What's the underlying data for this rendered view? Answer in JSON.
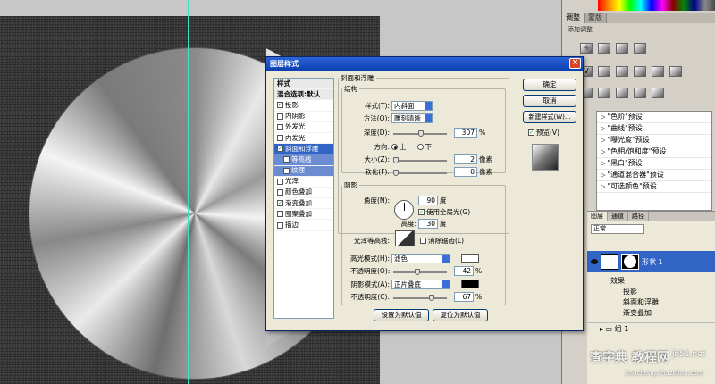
{
  "dialog": {
    "title": "图层样式",
    "style_list": {
      "header": "样式",
      "blend_options": "混合选项:默认",
      "items": [
        {
          "label": "投影",
          "checked": true
        },
        {
          "label": "内阴影",
          "checked": false
        },
        {
          "label": "外发光",
          "checked": false
        },
        {
          "label": "内发光",
          "checked": false
        },
        {
          "label": "斜面和浮雕",
          "checked": true,
          "selected": true
        },
        {
          "label": "等高线",
          "checked": false,
          "sub": true
        },
        {
          "label": "纹理",
          "checked": false,
          "sub": true
        },
        {
          "label": "光泽",
          "checked": false
        },
        {
          "label": "颜色叠加",
          "checked": false
        },
        {
          "label": "渐变叠加",
          "checked": true
        },
        {
          "label": "图案叠加",
          "checked": false
        },
        {
          "label": "描边",
          "checked": false
        }
      ]
    },
    "bevel": {
      "group_title": "斜面和浮雕",
      "structure_title": "结构",
      "style_label": "样式(T):",
      "style_value": "内斜面",
      "technique_label": "方法(Q):",
      "technique_value": "雕刻清晰",
      "depth_label": "深度(D):",
      "depth_value": "307",
      "depth_unit": "%",
      "direction_label": "方向:",
      "direction_up": "上",
      "direction_down": "下",
      "size_label": "大小(Z):",
      "size_value": "2",
      "size_unit": "像素",
      "soften_label": "软化(F):",
      "soften_value": "0",
      "soften_unit": "像素"
    },
    "shading": {
      "title": "阴影",
      "angle_label": "角度(N):",
      "angle_value": "90",
      "angle_unit": "度",
      "global_light_label": "使用全局光(G)",
      "altitude_label": "高度:",
      "altitude_value": "30",
      "altitude_unit": "度",
      "gloss_label": "光泽等高线:",
      "antialias_label": "消除锯齿(L)",
      "highlight_mode_label": "高光模式(H):",
      "highlight_mode_value": "滤色",
      "highlight_opacity_label": "不透明度(O):",
      "highlight_opacity_value": "42",
      "shadow_mode_label": "阴影模式(A):",
      "shadow_mode_value": "正片叠底",
      "shadow_opacity_label": "不透明度(C):",
      "shadow_opacity_value": "67",
      "percent": "%",
      "highlight_color": "#ffffff",
      "shadow_color": "#000000"
    },
    "buttons": {
      "set_default": "设置为默认值",
      "reset_default": "复位为默认值",
      "ok": "确定",
      "cancel": "取消",
      "new_style": "新建样式(W)...",
      "preview": "预览(V)"
    }
  },
  "panels": {
    "tabs": [
      "调整",
      "蒙版"
    ],
    "adjust_title": "添加调整",
    "presets": [
      "\"色阶\"预设",
      "\"曲线\"预设",
      "\"曝光度\"预设",
      "\"色相/饱和度\"预设",
      "\"黑白\"预设",
      "\"通道混合器\"预设",
      "\"可选颜色\"预设"
    ],
    "layer_tabs": [
      "图层",
      "通道",
      "路径"
    ],
    "blend_mode": "正常",
    "layer_name": "形状 1",
    "effects_label": "效果",
    "effects": [
      "投影",
      "斜面和浮雕",
      "渐变叠加"
    ],
    "group_name": "组 1"
  },
  "watermark": {
    "site": "jb51.net",
    "brand": "查字典 教程网",
    "url": "jiaocheng.chazidian.com"
  }
}
